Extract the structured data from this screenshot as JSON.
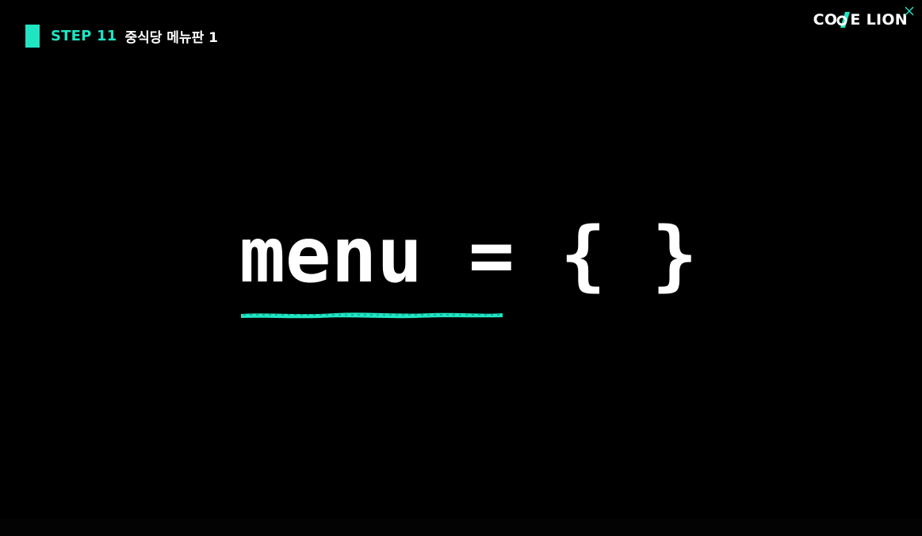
{
  "header": {
    "step_label": "STEP 11",
    "step_title": "중식당 메뉴판 1"
  },
  "logo": {
    "left_text": "CO",
    "right_text": "E LION"
  },
  "slide": {
    "code": "menu = { }"
  },
  "colors": {
    "accent": "#1fe5c3",
    "background": "#000000",
    "text": "#ffffff"
  },
  "icons": {
    "close": "close-icon",
    "marker": "step-marker"
  }
}
